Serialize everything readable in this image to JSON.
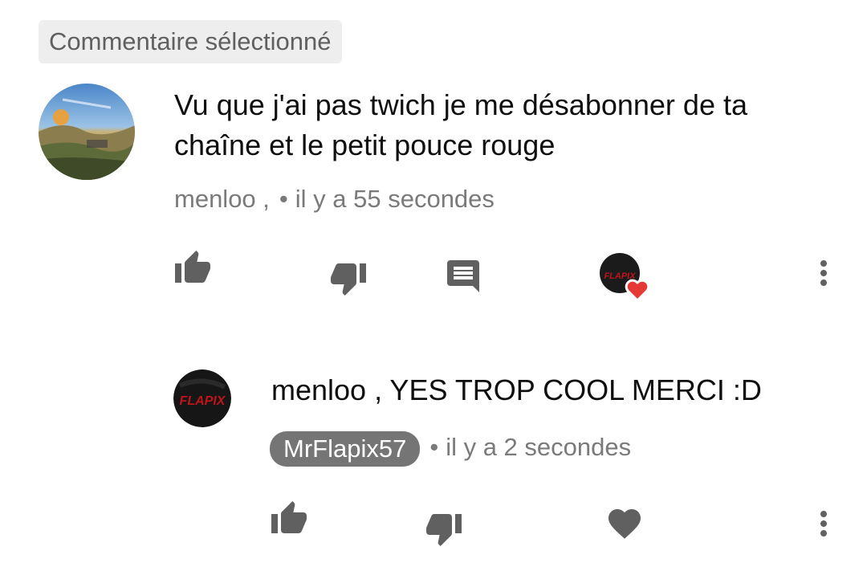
{
  "selected_label": "Commentaire sélectionné",
  "comment": {
    "text": "Vu que j'ai pas twich je me désabonner de ta chaîne et le petit pouce rouge",
    "author": "menloo ,",
    "separator": "•",
    "time": "il y a 55 secondes",
    "avatar": "landscape-avatar",
    "actions": [
      "like-icon",
      "dislike-icon",
      "reply-icon",
      "creator-heart-icon",
      "more-vert-icon"
    ]
  },
  "reply": {
    "text": "menloo , YES TROP COOL MERCI :D",
    "author_badge": "MrFlapix57",
    "separator": "•",
    "time": "il y a 2 secondes",
    "avatar_text": "FLAPIX",
    "actions": [
      "like-icon",
      "dislike-icon",
      "heart-icon",
      "more-vert-icon"
    ]
  },
  "colors": {
    "icon": "#606060",
    "heart_red": "#e53935",
    "badge_bg": "#757575",
    "chip_bg": "#eeeeee",
    "flapix_red": "#c0141b"
  }
}
